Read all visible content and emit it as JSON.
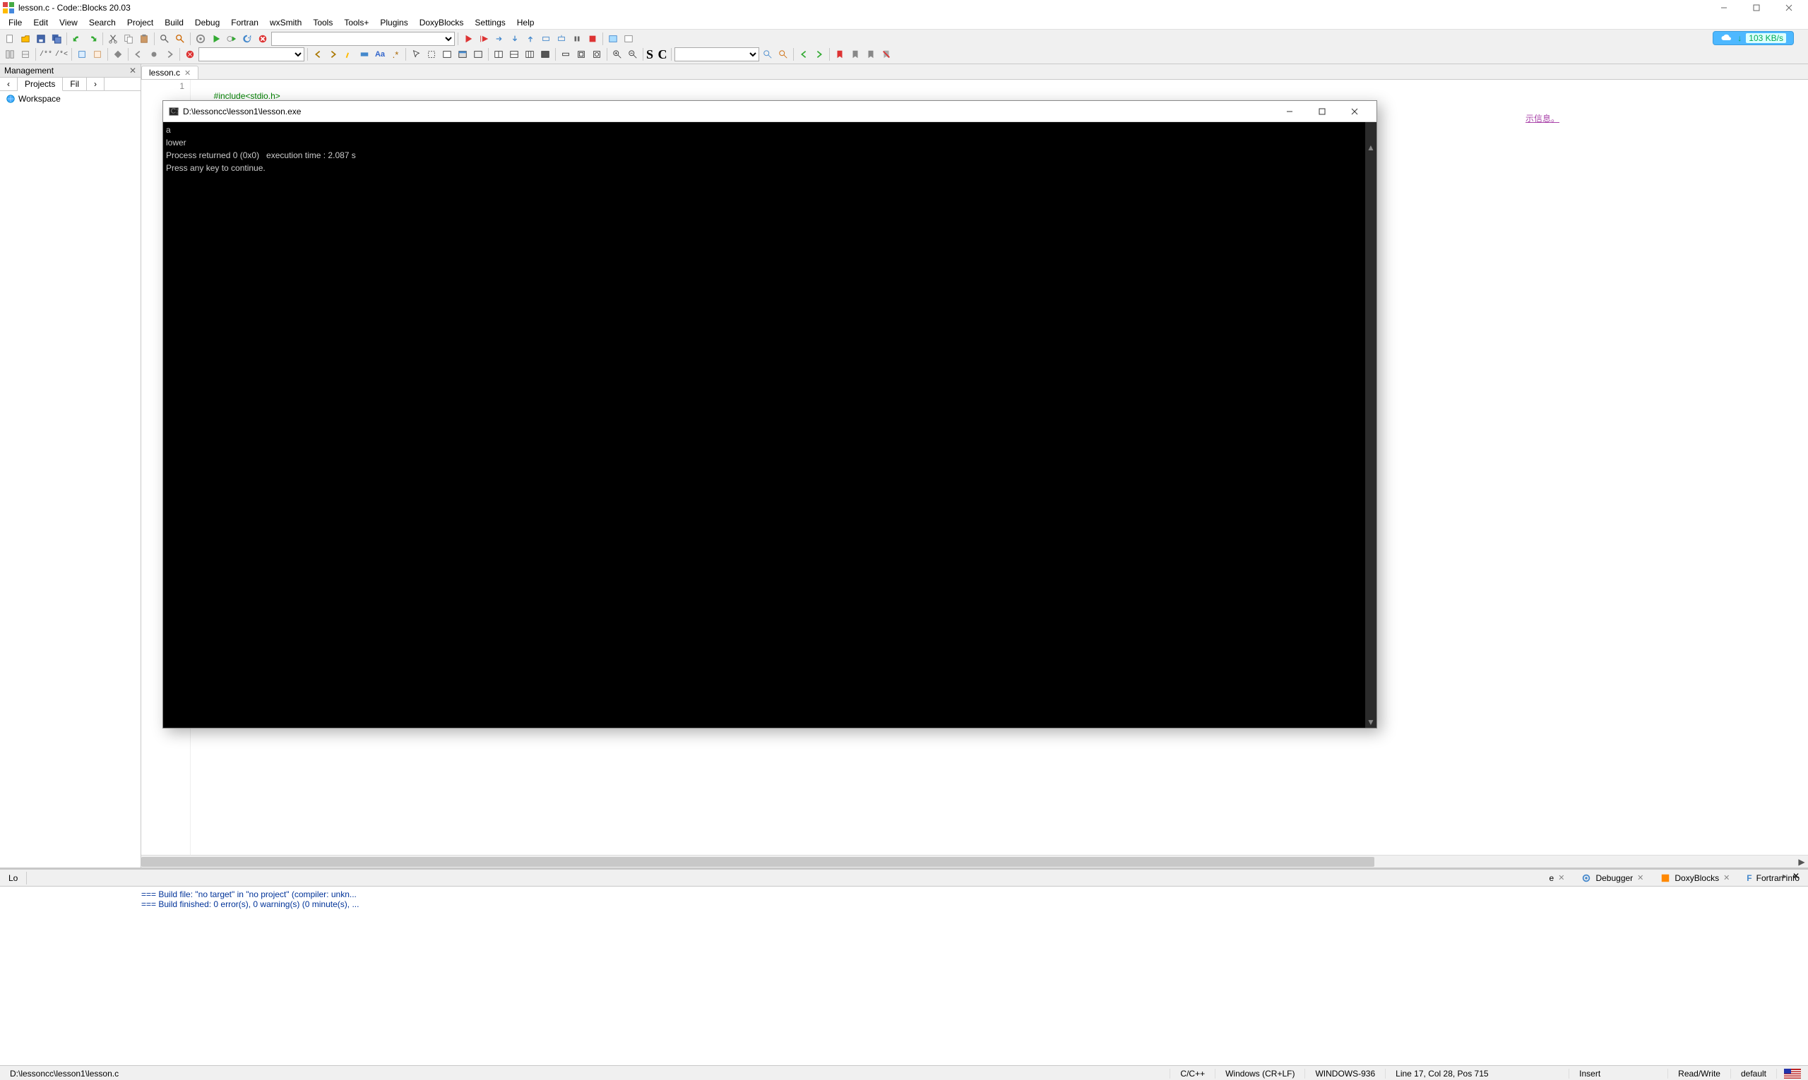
{
  "window": {
    "title": "lesson.c - Code::Blocks 20.03"
  },
  "menu": [
    "File",
    "Edit",
    "View",
    "Search",
    "Project",
    "Build",
    "Debug",
    "Fortran",
    "wxSmith",
    "Tools",
    "Tools+",
    "Plugins",
    "DoxyBlocks",
    "Settings",
    "Help"
  ],
  "netwidget": {
    "speed": "103 KB/s"
  },
  "management": {
    "title": "Management",
    "tabs": {
      "left_arrow": "‹",
      "projects": "Projects",
      "files": "Fil",
      "right_arrow": "›"
    },
    "workspace": "Workspace"
  },
  "editor": {
    "tab": "lesson.c",
    "gutter_line": "1",
    "code_line": "#include<stdio.h>",
    "hidden_fragment": "示信息。"
  },
  "console": {
    "title": "D:\\lessoncc\\lesson1\\lesson.exe",
    "lines": [
      "a",
      "lower",
      "Process returned 0 (0x0)   execution time : 2.087 s",
      "Press any key to continue."
    ]
  },
  "logs": {
    "tabs": [
      {
        "label": "Lo"
      },
      {
        "label": "e",
        "closable": true
      },
      {
        "label": "Debugger",
        "icon": "gear-blue",
        "closable": true
      },
      {
        "label": "DoxyBlocks",
        "icon": "doxy",
        "closable": true
      },
      {
        "label": "Fortran info",
        "icon": "fortran",
        "closable": true
      }
    ],
    "body": [
      "=== Build file: \"no target\" in \"no project\" (compiler: unkn...",
      "=== Build finished: 0 error(s), 0 warning(s) (0 minute(s), ..."
    ]
  },
  "status": {
    "path": "D:\\lessoncc\\lesson1\\lesson.c",
    "lang": "C/C++",
    "eol": "Windows (CR+LF)",
    "encoding": "WINDOWS-936",
    "pos": "Line 17, Col 28, Pos 715",
    "insert": "Insert",
    "rw": "Read/Write",
    "profile": "default"
  }
}
